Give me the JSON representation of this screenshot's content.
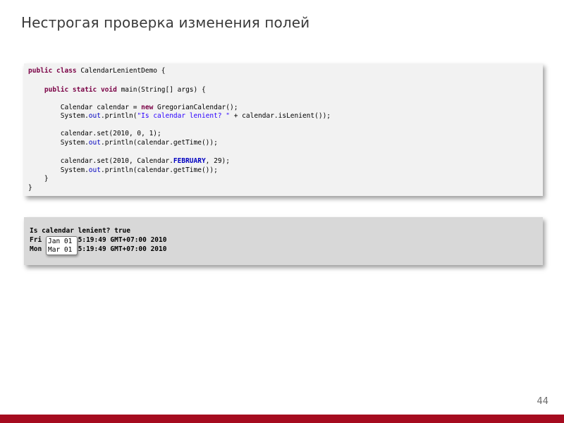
{
  "slide": {
    "title": "Нестрогая проверка изменения полей",
    "page_number": "44"
  },
  "code": {
    "l1_a": "public class",
    "l1_b": " CalendarLenientDemo {",
    "l3_a": "    ",
    "l3_b": "public static void",
    "l3_c": " main(String[] args) {",
    "l5_a": "        Calendar calendar = ",
    "l5_b": "new",
    "l5_c": " GregorianCalendar();",
    "l6_a": "        System.",
    "l6_b": "out",
    "l6_c": ".println(",
    "l6_d": "\"Is calendar lenient? \"",
    "l6_e": " + calendar.isLenient());",
    "l8": "        calendar.set(2010, 0, 1);",
    "l9_a": "        System.",
    "l9_b": "out",
    "l9_c": ".println(calendar.getTime());",
    "l11_a": "        calendar.set(2010, Calendar.",
    "l11_b": "FEBRUARY",
    "l11_c": ", 29);",
    "l12_a": "        System.",
    "l12_b": "out",
    "l12_c": ".println(calendar.getTime());",
    "l13": "    }",
    "l14": "}"
  },
  "output": {
    "line1": "Is calendar lenient? true",
    "line2": "Fri        15:19:49 GMT+07:00 2010",
    "line3": "Mon        15:19:49 GMT+07:00 2010"
  },
  "callout": {
    "date1": "Jan 01",
    "date2": "Mar 01"
  },
  "colors": {
    "footer": "#a50b1f",
    "keyword": "#7a0045",
    "field": "#0000c0",
    "string": "#2a00ff"
  }
}
